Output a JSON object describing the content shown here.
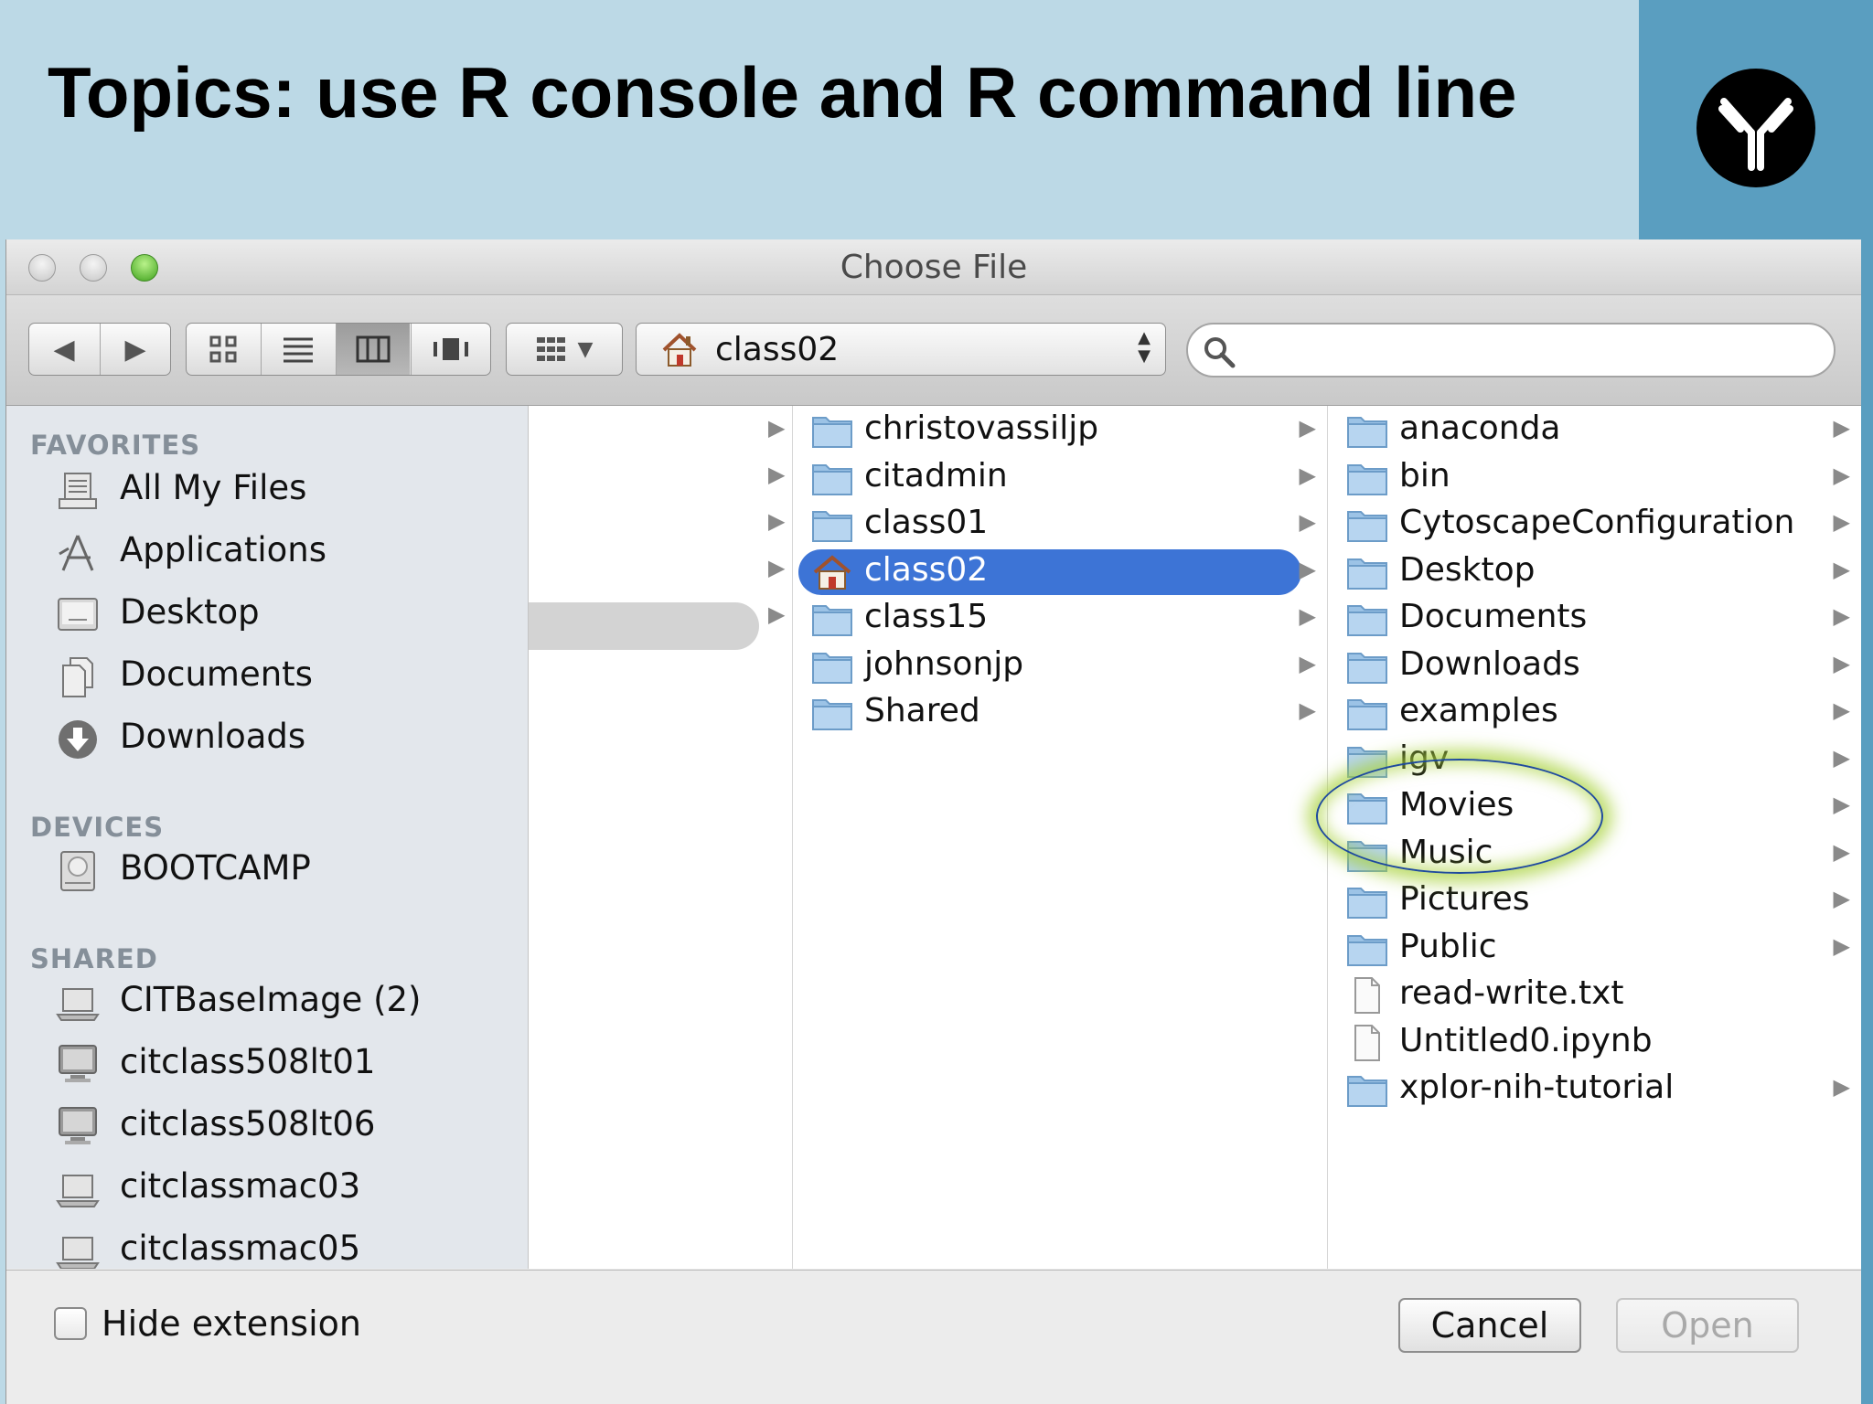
{
  "slide": {
    "title": "Topics: use R console and R command line"
  },
  "dialog": {
    "title": "Choose File"
  },
  "toolbar": {
    "path": "class02",
    "search_placeholder": ""
  },
  "sidebar": {
    "favorites_heading": "FAVORITES",
    "favorites": [
      {
        "label": "All My Files",
        "icon": "all-files-icon"
      },
      {
        "label": "Applications",
        "icon": "applications-icon"
      },
      {
        "label": "Desktop",
        "icon": "desktop-icon"
      },
      {
        "label": "Documents",
        "icon": "documents-icon"
      },
      {
        "label": "Downloads",
        "icon": "downloads-icon"
      }
    ],
    "devices_heading": "DEVICES",
    "devices": [
      {
        "label": "BOOTCAMP",
        "icon": "disk-icon"
      }
    ],
    "shared_heading": "SHARED",
    "shared": [
      {
        "label": "CITBaseImage (2)",
        "icon": "laptop-icon"
      },
      {
        "label": "citclass508lt01",
        "icon": "monitor-icon"
      },
      {
        "label": "citclass508lt06",
        "icon": "monitor-icon"
      },
      {
        "label": "citclassmac03",
        "icon": "laptop-icon"
      },
      {
        "label": "citclassmac05",
        "icon": "laptop-icon"
      }
    ]
  },
  "columns": {
    "users": [
      {
        "name": "christovassiljp",
        "arrow": "▶"
      },
      {
        "name": "citadmin",
        "arrow": "▶"
      },
      {
        "name": "class01",
        "arrow": "▶"
      },
      {
        "name": "class02",
        "arrow": "▶",
        "selected": true
      },
      {
        "name": "class15",
        "arrow": "▶"
      },
      {
        "name": "johnsonjp",
        "arrow": "▶"
      },
      {
        "name": "Shared",
        "arrow": "▶"
      }
    ],
    "home": [
      {
        "name": "anaconda",
        "arrow": "▶"
      },
      {
        "name": "bin",
        "arrow": "▶"
      },
      {
        "name": "CytoscapeConfiguration",
        "arrow": "▶"
      },
      {
        "name": "Desktop",
        "arrow": "▶"
      },
      {
        "name": "Documents",
        "arrow": "▶"
      },
      {
        "name": "Downloads",
        "arrow": "▶"
      },
      {
        "name": "examples",
        "arrow": "▶"
      },
      {
        "name": "igv",
        "arrow": "▶"
      },
      {
        "name": "Movies",
        "arrow": "▶"
      },
      {
        "name": "Music",
        "arrow": "▶"
      },
      {
        "name": "Pictures",
        "arrow": "▶"
      },
      {
        "name": "Public",
        "arrow": "▶"
      },
      {
        "name": "read-write.txt",
        "arrow": ""
      },
      {
        "name": "Untitled0.ipynb",
        "arrow": ""
      },
      {
        "name": "xplor-nih-tutorial",
        "arrow": "▶"
      }
    ]
  },
  "bottom": {
    "hide_extension_label": "Hide extension",
    "cancel_label": "Cancel",
    "open_label": "Open"
  },
  "colors": {
    "selection": "#3d74d6",
    "slide_bg": "#bcd9e6",
    "slide_accent": "#5a9ec0",
    "highlight": "#a8d23c"
  }
}
